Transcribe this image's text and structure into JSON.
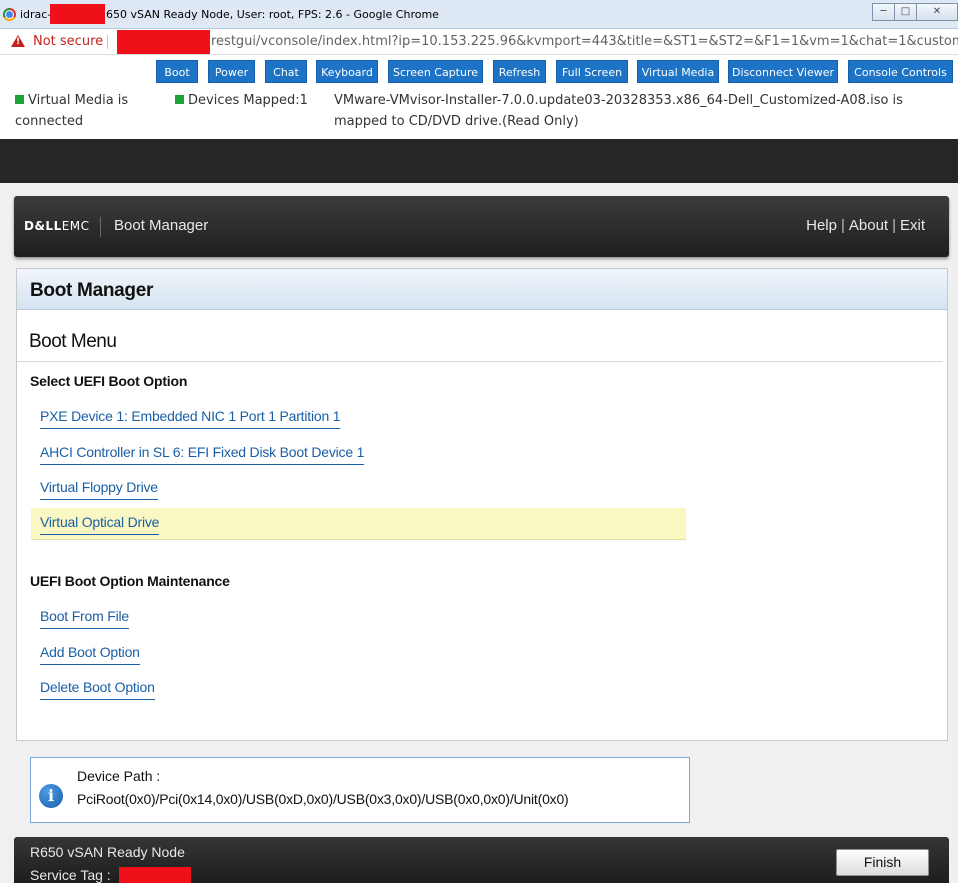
{
  "window": {
    "title_prefix": "idrac-",
    "title_suffix": "650 vSAN Ready Node, User: root, FPS: 2.6 - Google Chrome",
    "controls": [
      "minimize",
      "maximize",
      "close"
    ]
  },
  "addressbar": {
    "security_label": "Not secure",
    "url_tail": "restgui/vconsole/index.html?ip=10.153.225.96&kvmport=443&title=&ST1=&ST2=&F1=1&vm=1&chat=1&custom..."
  },
  "toolbar": {
    "buttons": [
      "Boot",
      "Power",
      "Chat",
      "Keyboard",
      "Screen Capture",
      "Refresh",
      "Full Screen",
      "Virtual Media",
      "Disconnect Viewer",
      "Console Controls"
    ],
    "button_color": "#1d74c6"
  },
  "status": {
    "virtual_media_l1": "Virtual Media is",
    "virtual_media_l2": "connected",
    "devices_mapped": "Devices Mapped:1",
    "iso_l1": "VMware-VMvisor-Installer-7.0.0.update03-20328353.x86_64-Dell_Customized-A08.iso is",
    "iso_l2": "mapped to CD/DVD drive.(Read Only)",
    "indicator_color": "#1ea33a"
  },
  "console": {
    "brand_dell": "D&LL",
    "brand_emc": "EMC",
    "header_title": "Boot Manager",
    "header_links": [
      "Help",
      "About",
      "Exit"
    ],
    "panel_title": "Boot Manager",
    "menu_title": "Boot Menu",
    "section_uefi": "Select UEFI Boot Option",
    "uefi_options": [
      "PXE Device 1: Embedded NIC 1 Port 1 Partition 1",
      "AHCI Controller in SL 6: EFI Fixed Disk Boot Device 1",
      "Virtual Floppy Drive",
      "Virtual Optical Drive"
    ],
    "highlighted_option": "Virtual Optical Drive",
    "section_maintenance": "UEFI Boot Option Maintenance",
    "maintenance_options": [
      "Boot From File",
      "Add Boot Option",
      "Delete Boot Option"
    ],
    "info_label": "Device Path :",
    "info_value": "PciRoot(0x0)/Pci(0x14,0x0)/USB(0xD,0x0)/USB(0x3,0x0)/USB(0x0,0x0)/Unit(0x0)",
    "footer_model": "R650 vSAN Ready Node",
    "footer_service_tag_label": "Service Tag :",
    "finish_label": "Finish",
    "highlight_color": "#f9f7c2",
    "link_color": "#1a5fa6"
  }
}
